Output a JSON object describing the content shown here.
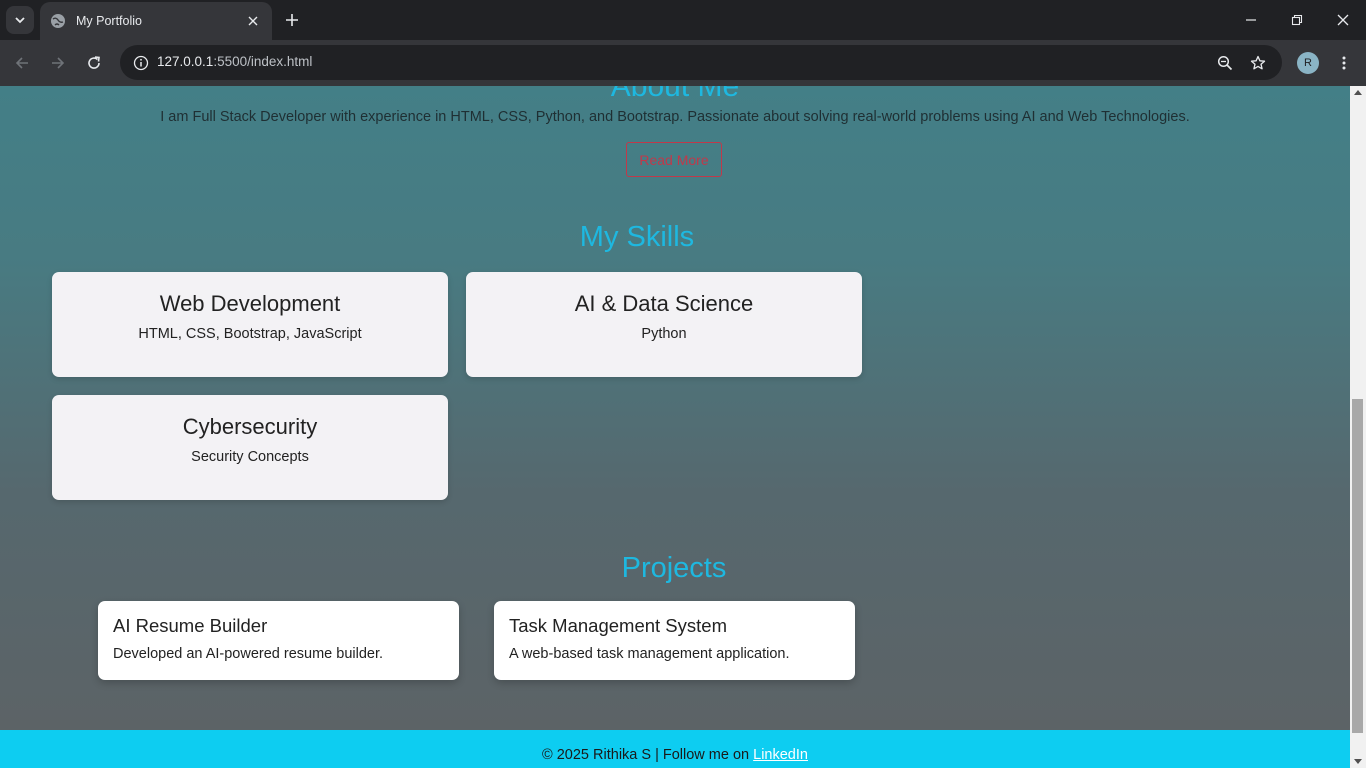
{
  "browser": {
    "tab_title": "My Portfolio",
    "url_host": "127.0.0.1",
    "url_path": ":5500/index.html",
    "profile_initial": "R"
  },
  "about": {
    "heading": "About Me",
    "text": "I am Full Stack Developer with experience in HTML, CSS, Python, and Bootstrap. Passionate about solving real-world problems using AI and Web Technologies.",
    "read_more_label": "Read More"
  },
  "skills": {
    "title": "My Skills",
    "items": [
      {
        "name": "Web Development",
        "desc": "HTML, CSS, Bootstrap, JavaScript"
      },
      {
        "name": "AI & Data Science",
        "desc": "Python"
      },
      {
        "name": "Cybersecurity",
        "desc": "Security Concepts"
      }
    ]
  },
  "projects": {
    "title": "Projects",
    "items": [
      {
        "name": "AI Resume Builder",
        "desc": "Developed an AI-powered resume builder."
      },
      {
        "name": "Task Management System",
        "desc": "A web-based task management application."
      }
    ]
  },
  "footer": {
    "text": "© 2025 Rithika S | Follow me on ",
    "link_label": "LinkedIn"
  },
  "colors": {
    "accent": "#1eb8e0",
    "footer_bg": "#0dcdf1",
    "read_more": "#c0394a"
  }
}
